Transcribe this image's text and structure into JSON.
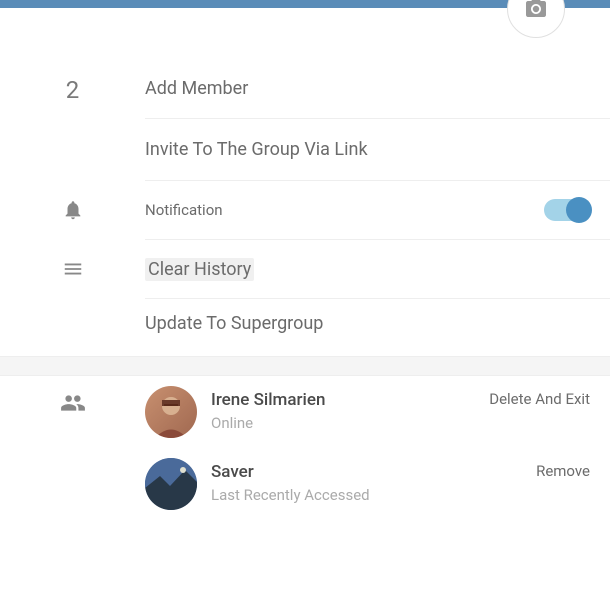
{
  "header": {
    "camera_icon": "camera"
  },
  "member_count": "2",
  "actions": {
    "add_member": "Add Member",
    "invite_link": "Invite To The Group Via Link",
    "notification": "Notification",
    "clear_history": "Clear History",
    "update_supergroup": "Update To Supergroup"
  },
  "notification_enabled": true,
  "members": [
    {
      "name": "Irene Silmarien",
      "status": "Online",
      "action": "Delete And Exit"
    },
    {
      "name": "Saver",
      "status": "Last Recently Accessed",
      "action": "Remove"
    }
  ]
}
